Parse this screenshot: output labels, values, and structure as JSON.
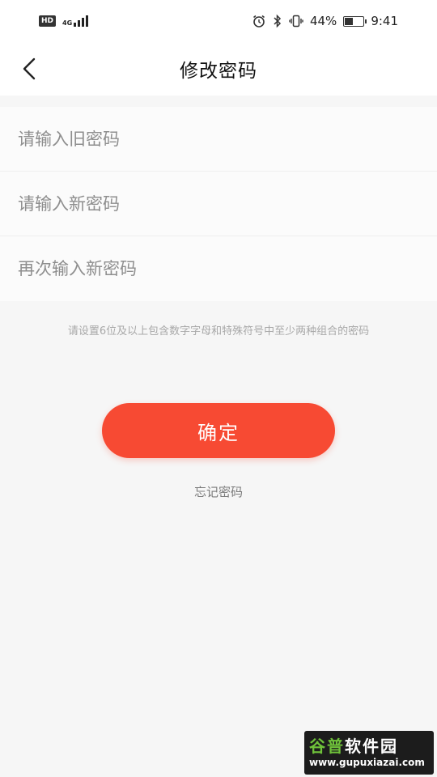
{
  "status_bar": {
    "hd": "HD",
    "network": "4G",
    "battery_percent": "44%",
    "battery_level": 0.44,
    "time": "9:41",
    "icons": [
      "alarm-icon",
      "bluetooth-icon",
      "vibrate-icon",
      "battery-icon"
    ]
  },
  "header": {
    "title": "修改密码",
    "back_icon": "chevron-left-icon"
  },
  "form": {
    "old_password_placeholder": "请输入旧密码",
    "new_password_placeholder": "请输入新密码",
    "confirm_password_placeholder": "再次输入新密码",
    "old_password_value": "",
    "new_password_value": "",
    "confirm_password_value": ""
  },
  "hint": "请设置6位及以上包含数字字母和特殊符号中至少两种组合的密码",
  "confirm_button": "确定",
  "forgot_link": "忘记密码",
  "colors": {
    "accent": "#f74a33",
    "background": "#f6f6f6"
  },
  "watermark": {
    "title_green": "谷普",
    "title_white": "软件园",
    "url": "www.gupuxiazai.com"
  }
}
